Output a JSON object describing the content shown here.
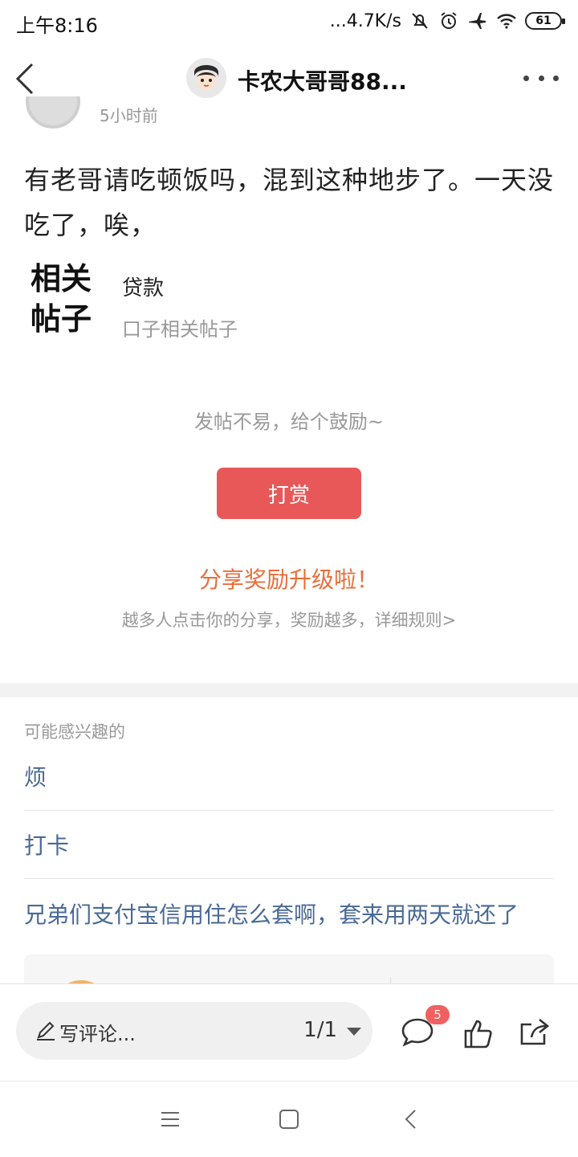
{
  "status_bar": {
    "time": "上午8:16",
    "net_speed": "...4.7K/s",
    "battery": "61"
  },
  "nav": {
    "title": "卡农大哥哥88..."
  },
  "post": {
    "time_partial": "5小时前",
    "body": "有老哥请吃顿饭吗，混到这种地步了。一天没吃了，唉，"
  },
  "related": {
    "label": "相关帖子",
    "title": "贷款",
    "subtitle": "口子相关帖子"
  },
  "reward": {
    "encourage_text": "发帖不易，给个鼓励~",
    "button_label": "打赏"
  },
  "share": {
    "title": "分享奖励升级啦！",
    "subtitle": "越多人点击你的分享，奖励越多，详细规则>"
  },
  "interest": {
    "heading": "可能感兴趣的",
    "items": [
      "烦",
      "打卡",
      "兄弟们支付宝信用住怎么套啊，套来用两天就还了"
    ]
  },
  "bottom_bar": {
    "comment_placeholder": "写评论...",
    "page_indicator": "1/1",
    "comment_count": "5"
  },
  "colors": {
    "accent_red": "#e85858",
    "share_orange": "#e76f3c",
    "link_blue": "#4a6a96"
  }
}
